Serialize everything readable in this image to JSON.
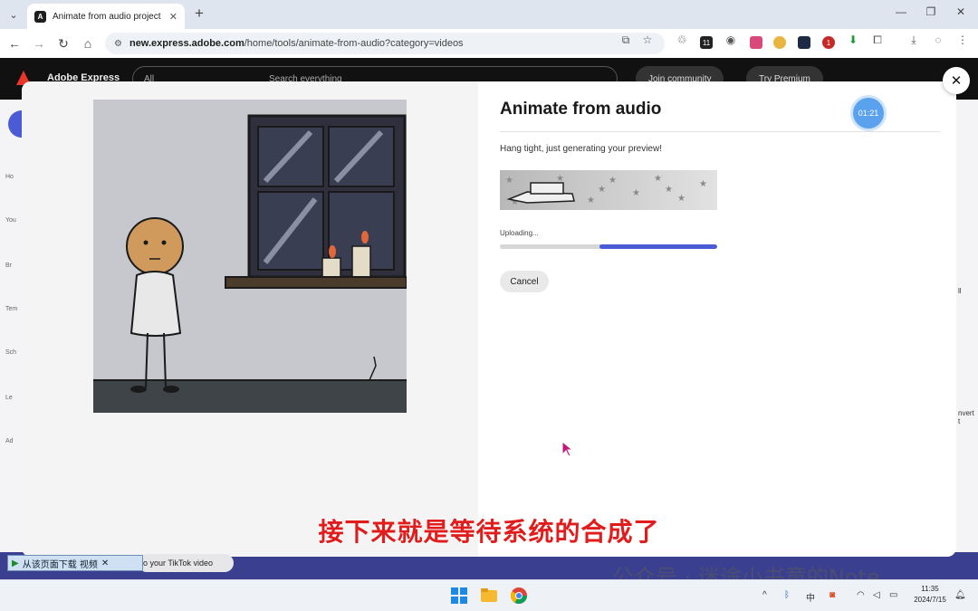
{
  "browser": {
    "tab_title": "Animate from audio project -",
    "url_host": "new.express.adobe.com",
    "url_path": "/home/tools/animate-from-audio?category=videos",
    "ext_badge_1": "11",
    "ext_badge_2": "1"
  },
  "adobe": {
    "brand": "Adobe Express",
    "search_scope": "All",
    "search_placeholder": "Search everything",
    "join_label": "Join community",
    "premium_label": "Try Premium",
    "sidebar": [
      "Ho",
      "You",
      "Br",
      "Tem",
      "Sch",
      "Le",
      "Ad"
    ],
    "right_fragments": [
      "ll",
      "nvert t"
    ]
  },
  "modal": {
    "title": "Animate from audio",
    "status": "Hang tight, just generating your preview!",
    "upload_label": "Uploading...",
    "progress": 0.54,
    "cancel_label": "Cancel",
    "timer": "01:21"
  },
  "overlay": {
    "subtitle": "接下来就是等待系统的合成了",
    "watermark": "公众号 · 迷途小书童的Note",
    "download_bar": "从该页面下载 视频",
    "tiktok_fragment": "o your TikTok video"
  },
  "taskbar": {
    "time": "11:35",
    "date": "2024/7/15"
  },
  "colors": {
    "accent": "#4b5bd6",
    "timer": "#5aa2ee",
    "subtitle": "#e01c1c"
  }
}
